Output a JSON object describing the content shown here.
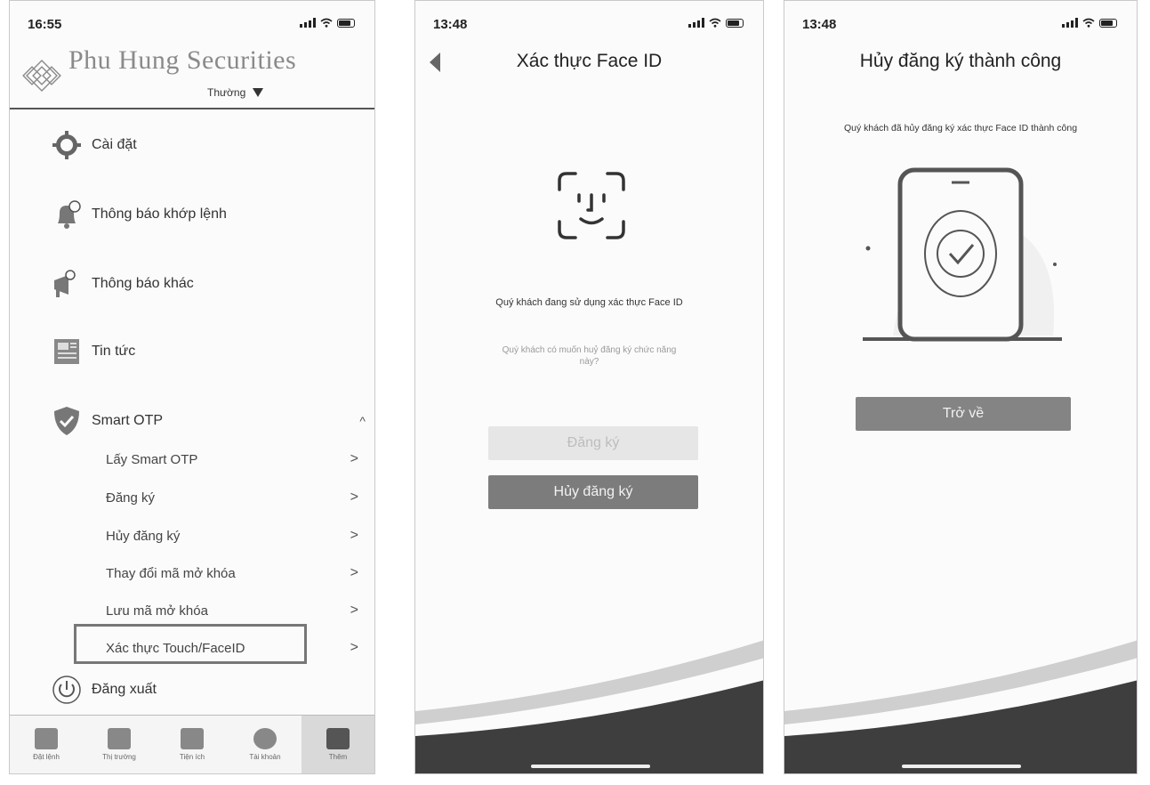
{
  "screen1": {
    "status_time": "16:55",
    "brand": "Phu Hung Securities",
    "account_level": "Thường",
    "menu": [
      {
        "label": "Cài đặt",
        "icon": "gear-icon"
      },
      {
        "label": "Thông báo khớp lệnh",
        "icon": "bell-icon"
      },
      {
        "label": "Thông báo khác",
        "icon": "megaphone-icon"
      },
      {
        "label": "Tin tức",
        "icon": "newspaper-icon"
      },
      {
        "label": "Smart OTP",
        "icon": "shield-check-icon",
        "expanded_glyph": "^"
      }
    ],
    "smart_otp_items": [
      {
        "label": "Lấy Smart OTP"
      },
      {
        "label": "Đăng ký"
      },
      {
        "label": "Hủy đăng ký"
      },
      {
        "label": "Thay đổi mã mở khóa"
      },
      {
        "label": "Lưu mã mở khóa"
      },
      {
        "label": "Xác thực Touch/FaceID"
      }
    ],
    "chevron": ">",
    "logout": "Đăng xuất",
    "tabs": [
      {
        "label": "Đặt lệnh",
        "icon": "order-icon"
      },
      {
        "label": "Thị trường",
        "icon": "market-icon"
      },
      {
        "label": "Tiện ích",
        "icon": "utilities-icon"
      },
      {
        "label": "Tài khoản",
        "icon": "account-icon"
      },
      {
        "label": "Thêm",
        "icon": "more-icon",
        "active": true
      }
    ]
  },
  "screen2": {
    "status_time": "13:48",
    "title": "Xác thực Face ID",
    "message": "Quý khách đang sử dụng xác thực Face ID",
    "question": "Quý khách có muốn huỷ đăng ký chức năng này?",
    "register_button": "Đăng ký",
    "unregister_button": "Hủy đăng ký"
  },
  "screen3": {
    "status_time": "13:48",
    "title": "Hủy đăng ký thành công",
    "message": "Quý khách đã hủy đăng ký xác thực Face ID thành công",
    "back_button": "Trở về"
  },
  "colors": {
    "primary_button": "#7c7c7c",
    "disabled_button": "#e6e6e6",
    "wave_dark": "#3e3e3e"
  }
}
